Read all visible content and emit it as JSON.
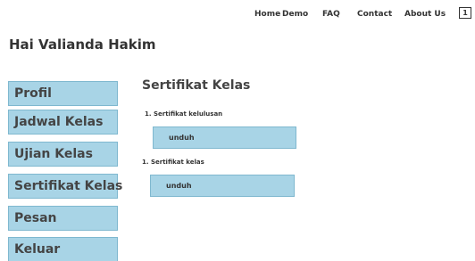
{
  "nav": {
    "items": [
      "Home",
      "Demo",
      "FAQ",
      "Contact",
      "About Us"
    ],
    "badge": "1"
  },
  "greeting": "Hai Valianda Hakim",
  "sidebar": {
    "items": [
      {
        "label": "Profil"
      },
      {
        "label": "Jadwal Kelas"
      },
      {
        "label": "Ujian Kelas"
      },
      {
        "label": "Sertifikat Kelas"
      },
      {
        "label": "Pesan"
      },
      {
        "label": "Keluar"
      }
    ]
  },
  "main": {
    "title": "Sertifikat Kelas",
    "certificates": [
      {
        "label": "1. Sertifikat kelulusan",
        "button": "unduh"
      },
      {
        "label": "1. Sertifikat kelas",
        "button": "unduh"
      }
    ]
  },
  "colors": {
    "menu_bg": "#a8d4e6",
    "menu_border": "#7fb8cf",
    "text": "#333333"
  }
}
